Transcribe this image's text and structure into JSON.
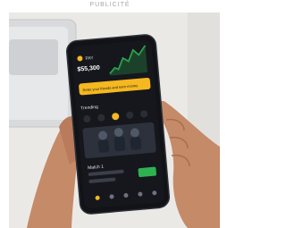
{
  "ad_label": "PUBLICITÉ",
  "colors": {
    "background": "#ffffff",
    "desk": "#ebe9e6",
    "laptop": "#d9dadc",
    "phone_body": "#111317",
    "screen": "#15171c",
    "accent_yellow": "#f5b820",
    "accent_green": "#2fb152",
    "skin": "#c58a68"
  },
  "phone": {
    "balance_label": "PAY",
    "balance_value": "$55,300",
    "promo_banner": "Refer your friends and earn money",
    "section_title": "Trending",
    "list_item": "Match 1"
  }
}
